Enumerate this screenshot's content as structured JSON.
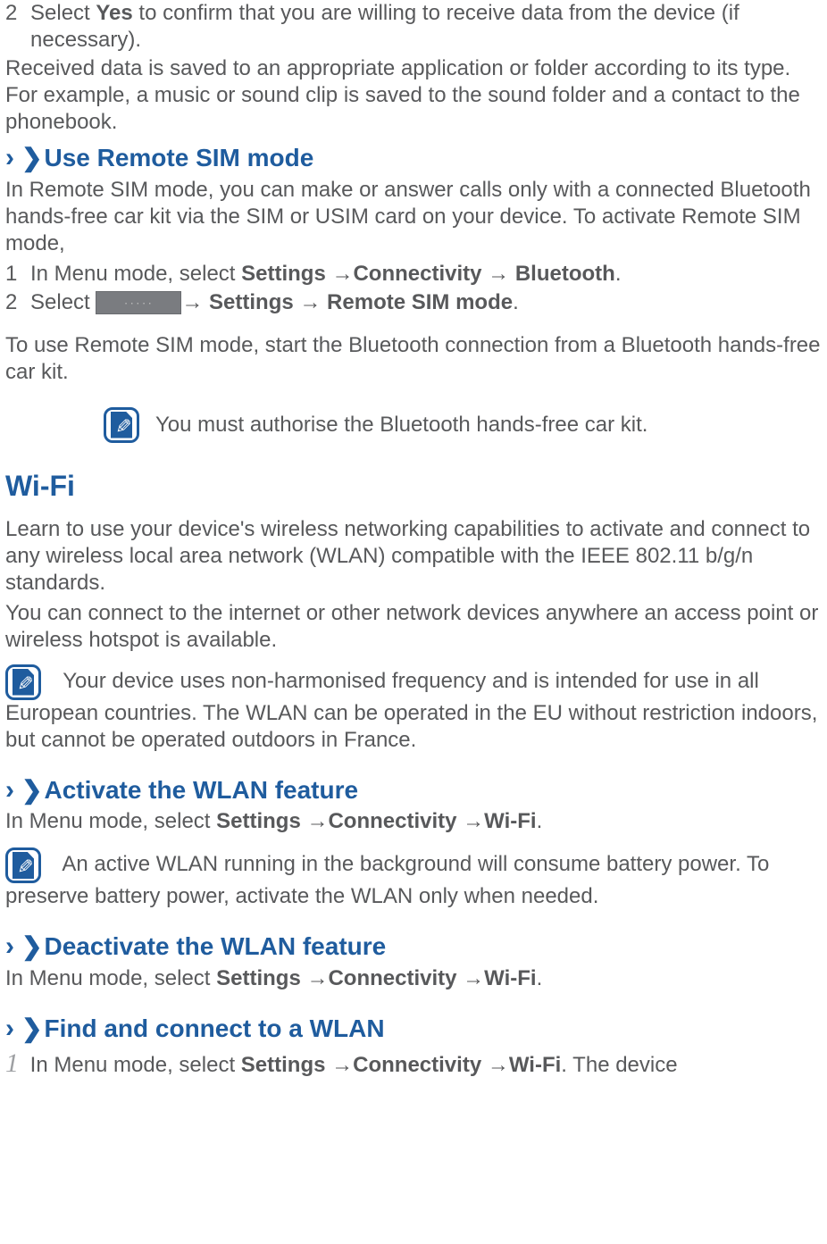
{
  "step2_top": {
    "num": "2",
    "text_a": "Select ",
    "yes": "Yes",
    "text_b": " to confirm that you are willing to receive data from the device (if necessary)."
  },
  "para_received": "Received data is saved to an appropriate application or folder according to its type. For example, a music or sound clip is saved to the sound folder and a contact to the phonebook.",
  "remote_sim": {
    "title": "Use Remote SIM mode",
    "intro": "In Remote SIM mode, you can make or answer calls only with a connected Bluetooth hands-free car kit via the SIM or USIM card on your device. To activate Remote SIM mode,",
    "step1": {
      "num": "1",
      "a": "In Menu mode, select ",
      "b": "Settings ",
      "c": "→",
      "d": "Connectivity ",
      "e": "→ Bluetooth",
      "f": "."
    },
    "step2": {
      "num": "2",
      "a": "Select  ",
      "b": "→ Settings → Remote SIM mode",
      "c": "."
    },
    "after": "To use Remote SIM mode, start the Bluetooth connection from a Bluetooth hands-free car kit.",
    "note": "You must authorise the Bluetooth hands-free car kit."
  },
  "wifi": {
    "title": "Wi-Fi",
    "p1": "Learn to use your device's wireless networking capabilities to activate and connect to any wireless local area network (WLAN) compatible with the IEEE 802.11 b/g/n standards.",
    "p2": "You can connect to the internet or other network devices anywhere an access point or wireless hotspot is available.",
    "note1": "Your device uses non-harmonised frequency and is intended for use in all European countries. The WLAN can be operated in the EU without restriction indoors, but cannot be operated outdoors in France."
  },
  "activate": {
    "title": "Activate the WLAN feature",
    "a": "In Menu mode, select ",
    "b": "Settings ",
    "c": "→",
    "d": "Connectivity ",
    "e": "→",
    "f": "Wi-Fi",
    "g": ".",
    "note": "An active WLAN running in the background will consume battery power. To preserve battery power, activate the WLAN only when needed."
  },
  "deactivate": {
    "title": "Deactivate the WLAN feature",
    "a": "In Menu mode, select ",
    "b": "Settings ",
    "c": "→",
    "d": "Connectivity ",
    "e": "→",
    "f": "Wi-Fi",
    "g": "."
  },
  "find": {
    "title": "Find and connect to a WLAN",
    "num": "1",
    "a": " In Menu mode, select ",
    "b": "Settings ",
    "c": "→",
    "d": "Connectivity ",
    "e": "→",
    "f": "Wi-Fi",
    "g": ". The device"
  },
  "chevron": "›",
  "chevron2": "❯"
}
